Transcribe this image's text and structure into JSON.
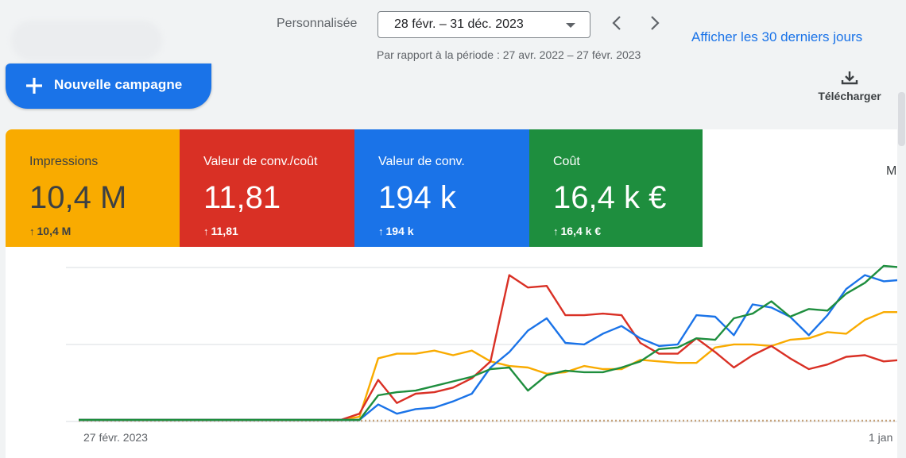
{
  "header": {
    "period_label": "Personnalisée",
    "date_range": "28 févr. – 31 déc. 2023",
    "compare_text": "Par rapport à la période : 27 avr. 2022 – 27 févr. 2023",
    "last_30_link": "Afficher les 30 derniers jours",
    "prev_icon": "chevron-left-icon",
    "next_icon": "chevron-right-icon"
  },
  "actions": {
    "new_campaign_label": "Nouvelle campagne",
    "download_label": "Télécharger",
    "plus_icon": "plus-icon",
    "download_icon": "download-icon"
  },
  "metrics": [
    {
      "title": "Impressions",
      "value": "10,4 M",
      "delta": "10,4 M",
      "color": "#f9ab00"
    },
    {
      "title": "Valeur de conv./coût",
      "value": "11,81",
      "delta": "11,81",
      "color": "#d93025"
    },
    {
      "title": "Valeur de conv.",
      "value": "194 k",
      "delta": "194 k",
      "color": "#1a73e8"
    },
    {
      "title": "Coût",
      "value": "16,4 k €",
      "delta": "16,4 k €",
      "color": "#1e8e3e"
    }
  ],
  "edge_text": "M",
  "chart_data": {
    "type": "line",
    "x_labels": [
      "27 févr. 2023",
      "1 jan"
    ],
    "ylim": [
      0,
      100
    ],
    "grid": true,
    "series": [
      {
        "metric": "Impressions",
        "color": "#f9ab00",
        "values": [
          0,
          0,
          0,
          0,
          0,
          0,
          0,
          0,
          0,
          0,
          0,
          0,
          0,
          0,
          0,
          2,
          40,
          43,
          43,
          45,
          42,
          45,
          38,
          35,
          34,
          30,
          31,
          35,
          33,
          33,
          39,
          38,
          37,
          37,
          47,
          49,
          49,
          48,
          52,
          53,
          57,
          56,
          65,
          70,
          70,
          75
        ]
      },
      {
        "metric": "Valeur de conv./coût",
        "color": "#d93025",
        "values": [
          0,
          0,
          0,
          0,
          0,
          0,
          0,
          0,
          0,
          0,
          0,
          0,
          0,
          0,
          0,
          4,
          26,
          11,
          17,
          18,
          21,
          27,
          38,
          94,
          86,
          87,
          68,
          68,
          69,
          68,
          50,
          43,
          43,
          53,
          44,
          34,
          42,
          48,
          40,
          33,
          36,
          41,
          42,
          38,
          39,
          25
        ]
      },
      {
        "metric": "Valeur de conv.",
        "color": "#1a73e8",
        "values": [
          0,
          0,
          0,
          0,
          0,
          0,
          0,
          0,
          0,
          0,
          0,
          0,
          0,
          0,
          0,
          0,
          10,
          4,
          7,
          8,
          12,
          17,
          34,
          44,
          58,
          66,
          50,
          49,
          56,
          61,
          53,
          48,
          49,
          68,
          67,
          55,
          75,
          73,
          67,
          55,
          68,
          85,
          94,
          90,
          91,
          58
        ]
      },
      {
        "metric": "Coût",
        "color": "#1e8e3e",
        "values": [
          0,
          0,
          0,
          0,
          0,
          0,
          0,
          0,
          0,
          0,
          0,
          0,
          0,
          0,
          0,
          0,
          16,
          18,
          19,
          22,
          25,
          28,
          33,
          34,
          19,
          29,
          32,
          31,
          31,
          34,
          38,
          46,
          47,
          53,
          52,
          66,
          69,
          77,
          67,
          72,
          71,
          82,
          89,
          100,
          99,
          96
        ]
      }
    ]
  }
}
